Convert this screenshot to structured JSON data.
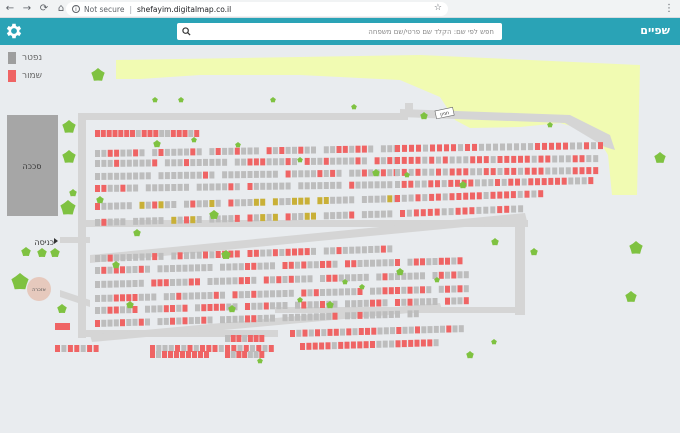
{
  "browser": {
    "security_label": "Not secure",
    "url": "shefayim.digitalmap.co.il",
    "back_glyph": "←",
    "forward_glyph": "→",
    "reload_glyph": "⟳",
    "home_glyph": "⌂",
    "star_glyph": "☆",
    "menu_glyph": "⋮"
  },
  "header": {
    "brand": "שפיים",
    "search_placeholder": "חפש לפי שם: הקלד שם פרטי/שם משפחה",
    "background": "#2aa3b6"
  },
  "legend": [
    {
      "label": "נפטר",
      "color": "#9e9e9e"
    },
    {
      "label": "שמור",
      "color": "#ef6464"
    }
  ],
  "map_labels": {
    "synagogue": "סככה",
    "entrance": "כניסה",
    "services": "אזכרה",
    "sign": "חניון"
  },
  "colors": {
    "deceased": "#bdbdbd",
    "reserved": "#ef6464",
    "highlight": "#c9b037",
    "path": "#d5d5d5",
    "lawn": "#f1fbb2",
    "tree": "#7fc241",
    "building": "#a6a6a6",
    "services_circle": "#e6c9bd"
  }
}
